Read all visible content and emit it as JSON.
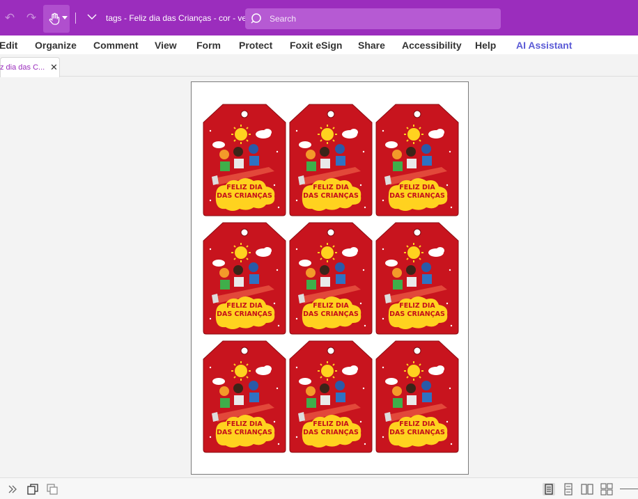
{
  "titlebar": {
    "document_title": "tags - Feliz dia das Crianças - cor - ve...",
    "search_placeholder": "Search",
    "icons": [
      "undo-icon",
      "redo-icon",
      "hand-tool-icon",
      "customize-chevron-icon",
      "search-icon"
    ]
  },
  "menu": {
    "items": [
      "Edit",
      "Organize",
      "Comment",
      "View",
      "Form",
      "Protect",
      "Foxit eSign",
      "Share",
      "Accessibility",
      "Help",
      "AI Assistant"
    ]
  },
  "tab": {
    "label": "z dia das C...",
    "close": "✕"
  },
  "page": {
    "tags": [
      {
        "line1": "FELIZ DIA",
        "line2": "DAS CRIANÇAS"
      },
      {
        "line1": "FELIZ DIA",
        "line2": "DAS CRIANÇAS"
      },
      {
        "line1": "FELIZ DIA",
        "line2": "DAS CRIANÇAS"
      },
      {
        "line1": "FELIZ DIA",
        "line2": "DAS CRIANÇAS"
      },
      {
        "line1": "FELIZ DIA",
        "line2": "DAS CRIANÇAS"
      },
      {
        "line1": "FELIZ DIA",
        "line2": "DAS CRIANÇAS"
      },
      {
        "line1": "FELIZ DIA",
        "line2": "DAS CRIANÇAS"
      },
      {
        "line1": "FELIZ DIA",
        "line2": "DAS CRIANÇAS"
      },
      {
        "line1": "FELIZ DIA",
        "line2": "DAS CRIANÇAS"
      }
    ]
  },
  "colors": {
    "accent": "#9b2dbd",
    "tag_red": "#c8141e",
    "tag_yellow": "#ffd21f",
    "ai_blue": "#5b5bd6"
  },
  "statusbar": {
    "icons": [
      "expand-panel-icon",
      "page-thumbnail-icon",
      "page-copy-icon",
      "single-page-view-icon",
      "continuous-view-icon",
      "facing-view-icon",
      "continuous-facing-view-icon"
    ]
  }
}
